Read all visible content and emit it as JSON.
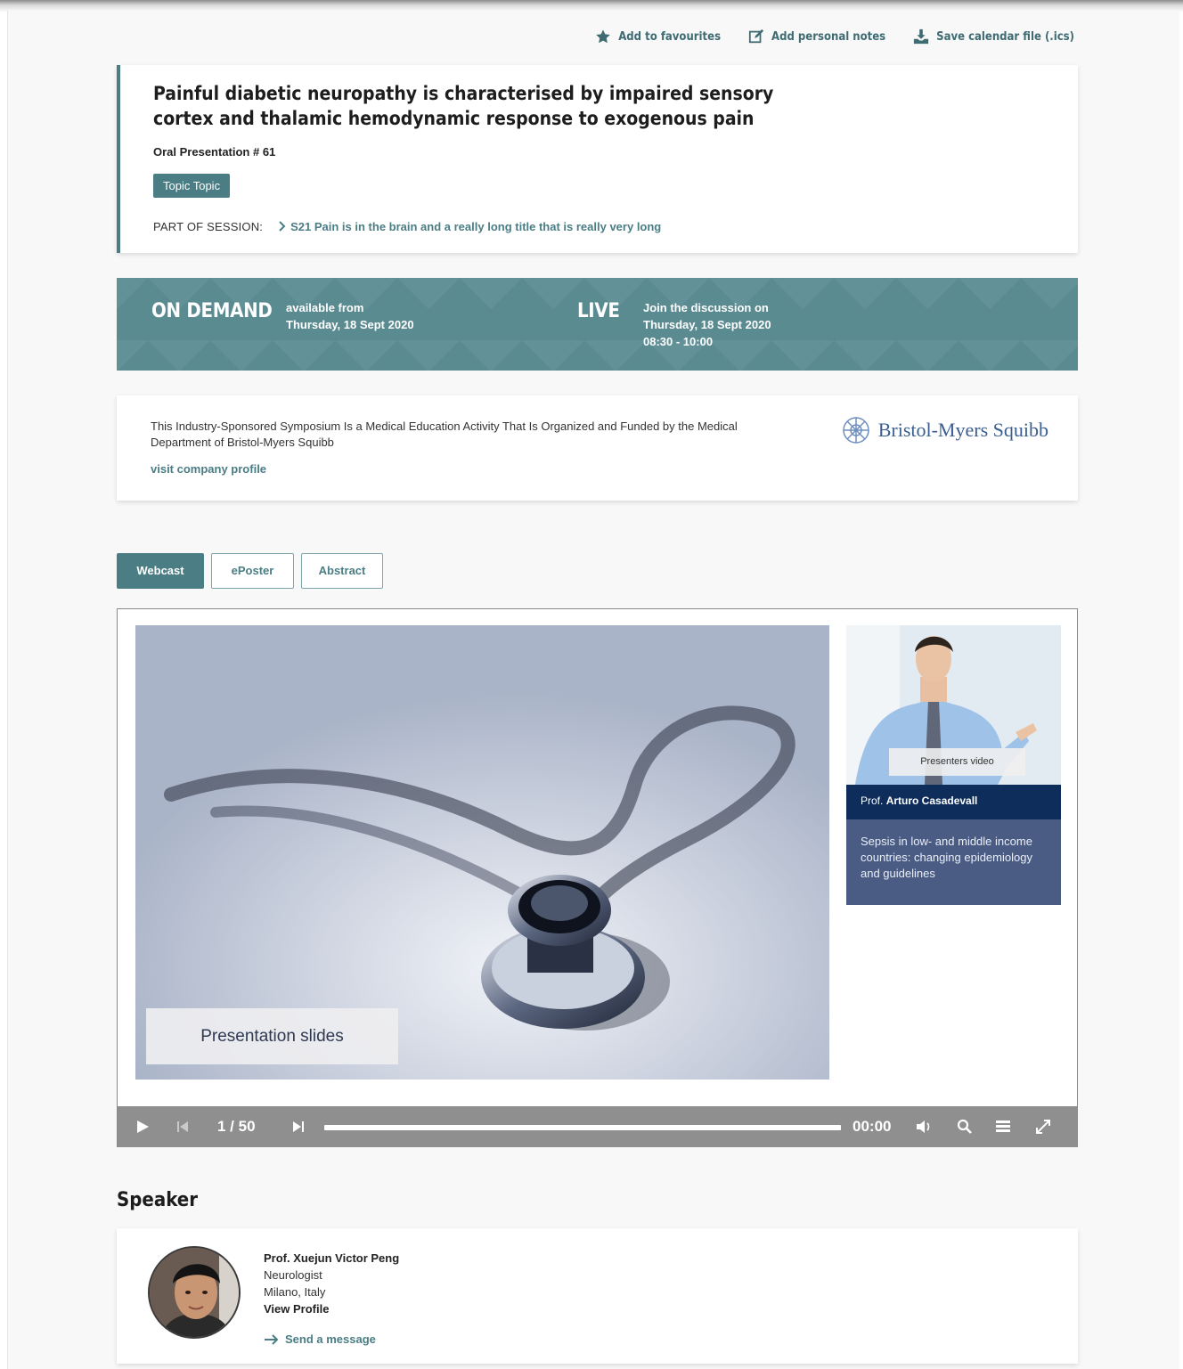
{
  "actions": {
    "favourites": "Add to favourites",
    "notes": "Add personal notes",
    "calendar": "Save calendar file (.ics)"
  },
  "presentation": {
    "title": "Painful diabetic neuropathy is characterised by impaired sensory cortex and thalamic hemodynamic response to exogenous pain",
    "subtitle": "Oral Presentation # 61",
    "topic": "Topic Topic",
    "session_label": "PART OF SESSION:",
    "session_link": "S21 Pain is in the brain and a really long title that is really very long"
  },
  "banner": {
    "on_demand": "ON DEMAND",
    "on_demand_line1": "available from",
    "on_demand_line2": "Thursday, 18 Sept 2020",
    "live": "LIVE",
    "live_line1": "Join the discussion on",
    "live_line2": "Thursday, 18 Sept 2020",
    "live_line3": "08:30 - 10:00"
  },
  "sponsor": {
    "text": "This Industry-Sponsored Symposium Is a Medical Education Activity That Is Organized and Funded by the Medical Department of Bristol-Myers Squibb",
    "link": "visit company profile",
    "logo_name": "Bristol-Myers Squibb"
  },
  "tabs": [
    {
      "label": "Webcast",
      "active": true
    },
    {
      "label": "ePoster",
      "active": false
    },
    {
      "label": "Abstract",
      "active": false
    }
  ],
  "player": {
    "slide_label": "Presentation slides",
    "presenter_video_label": "Presenters video",
    "presenter_honorific": "Prof.",
    "presenter_name": "Arturo Casadevall",
    "talk_title": "Sepsis in low- and middle income countries: changing epidemiology and guidelines",
    "page_counter": "1 / 50",
    "time": "00:00",
    "progress": 0.0
  },
  "speaker": {
    "heading": "Speaker",
    "name": "Prof. Xuejun Victor Peng",
    "role": "Neurologist",
    "location": "Milano, Italy",
    "view_profile": "View Profile",
    "send_message": "Send a message"
  },
  "colors": {
    "accent": "#4a7d84",
    "banner": "#5a8b91",
    "presenter_name_bg": "#0f2d5a",
    "presenter_talk_bg": "#4a5c84"
  }
}
